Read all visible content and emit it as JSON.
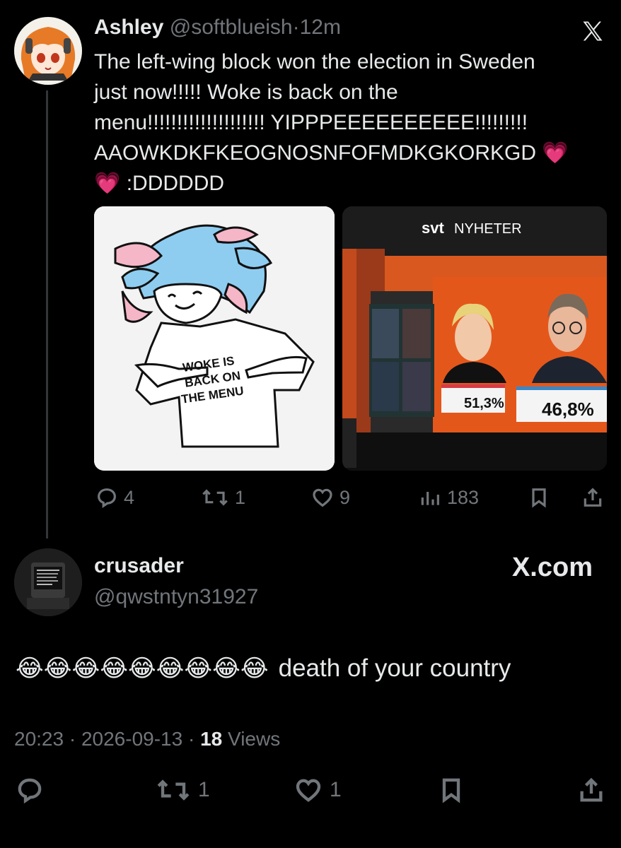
{
  "post": {
    "name": "Ashley",
    "handle": "@softblueish",
    "separator": "·",
    "time": "12m",
    "text_lines": [
      "The left-wing block won the election in Sweden",
      "just now!!!!! Woke is back on the",
      "menu!!!!!!!!!!!!!!!!!!!! YIPPPEEEEEEEEEE!!!!!!!!!",
      "AAOWKDKFKEOGNOSNFOFMDKGKORKGD",
      ":DDDDDD"
    ],
    "heart_emoji": "💗",
    "media": {
      "left_shirt_text": [
        "WOKE IS",
        "BACK ON",
        "THE MENU"
      ],
      "right_brand": "svt",
      "right_brand_suffix": "NYHETER",
      "right_result_left": "51,3%",
      "right_result_right": "46,8%"
    },
    "actions": {
      "replies": "4",
      "reposts": "1",
      "likes": "9",
      "views": "183"
    }
  },
  "reply": {
    "name": "crusader",
    "handle": "@qwstntyn31927",
    "site": "X.com",
    "emoji": "😂",
    "emoji_count": 9,
    "text": "death of your country"
  },
  "meta": {
    "time": "20:23",
    "separator": "·",
    "date": "2026-09-13",
    "views_count": "18",
    "views_label": "Views"
  },
  "bottom_actions": {
    "reposts": "1",
    "likes": "1"
  },
  "colors": {
    "background": "#000000",
    "text": "#e7e9ea",
    "muted": "#71767b",
    "heart": "#f06bd3",
    "svt_orange": "#e4571b"
  },
  "icons": [
    "x-logo-icon",
    "reply-icon",
    "repost-icon",
    "like-icon",
    "views-icon",
    "bookmark-icon",
    "share-icon"
  ]
}
